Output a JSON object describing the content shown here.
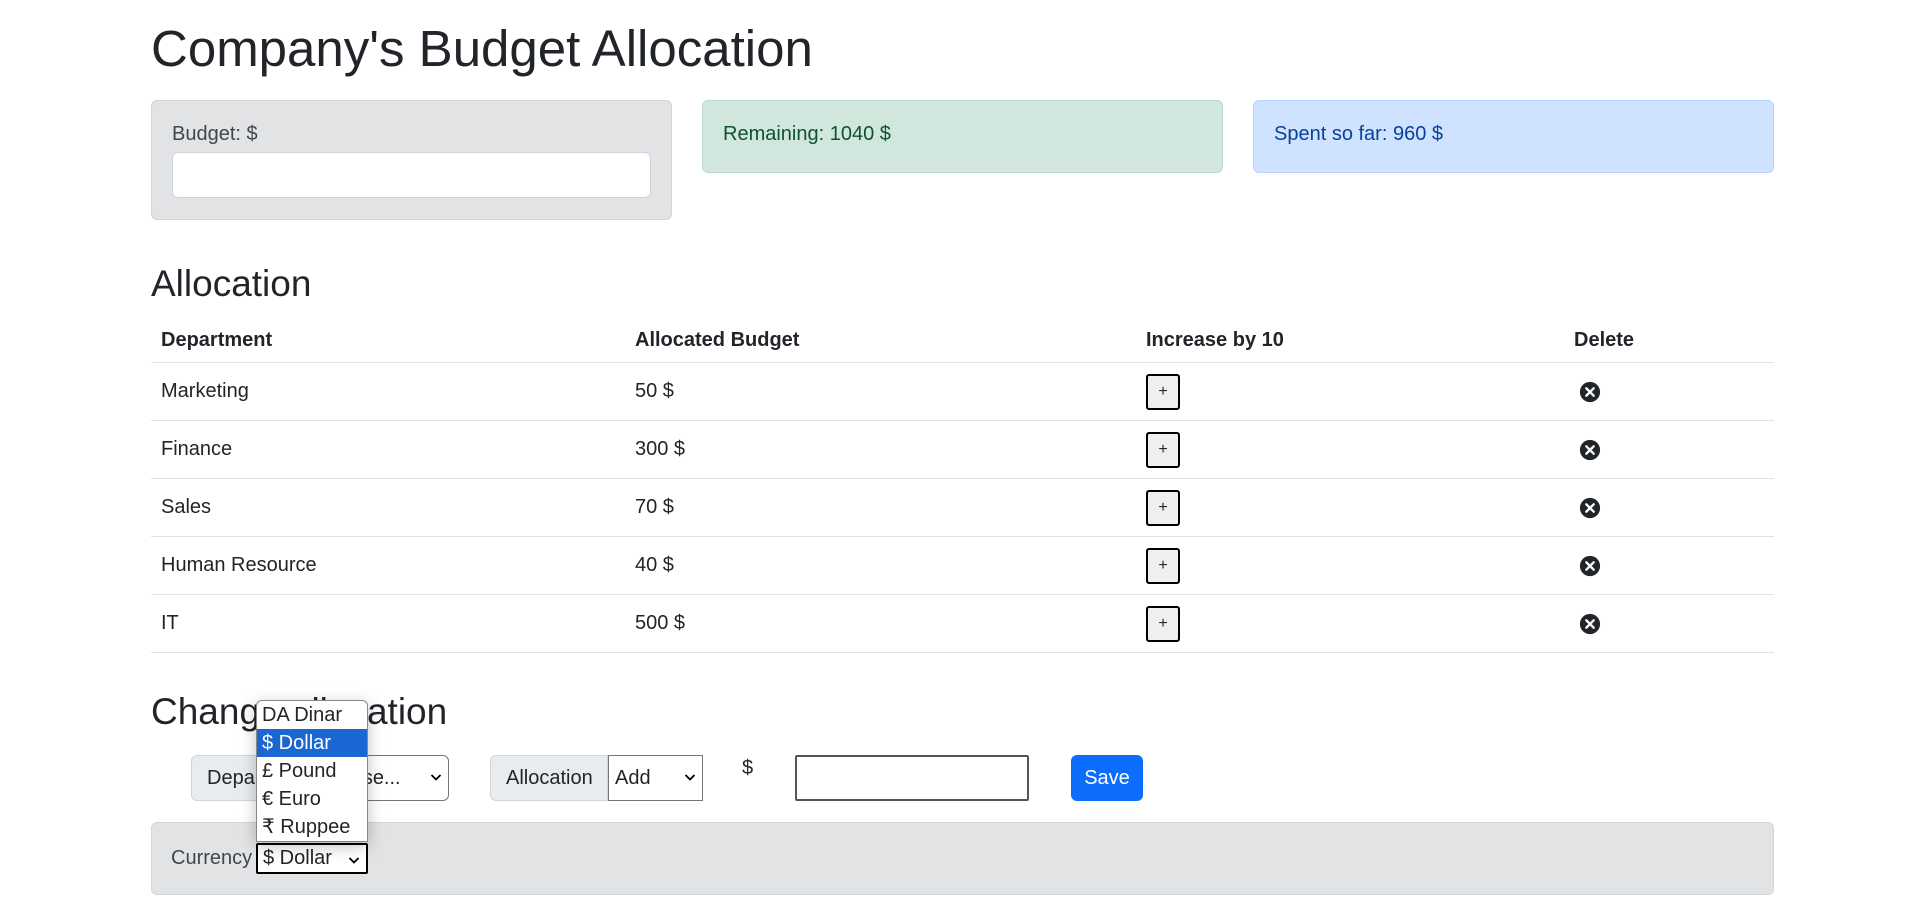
{
  "title": "Company's Budget Allocation",
  "cards": {
    "budget_label": "Budget: $",
    "budget_value": "",
    "remaining": "Remaining: 1040 $",
    "spent": "Spent so far: 960 $"
  },
  "allocation": {
    "heading": "Allocation",
    "headers": [
      "Department",
      "Allocated Budget",
      "Increase by 10",
      "Delete"
    ],
    "rows": [
      {
        "department": "Marketing",
        "budget": "50 $",
        "plus": "+"
      },
      {
        "department": "Finance",
        "budget": "300 $",
        "plus": "+"
      },
      {
        "department": "Sales",
        "budget": "70 $",
        "plus": "+"
      },
      {
        "department": "Human Resource",
        "budget": "40 $",
        "plus": "+"
      },
      {
        "department": "IT",
        "budget": "500 $",
        "plus": "+"
      }
    ]
  },
  "change": {
    "heading": "Change allocation",
    "department_label": "Department",
    "department_selected": "Choose...",
    "allocation_label": "Allocation",
    "action_selected": "Add",
    "currency_sign": "$",
    "amount_value": "",
    "save_label": "Save"
  },
  "currency": {
    "label": "Currency",
    "selected": "$ Dollar",
    "options": [
      "DA Dinar",
      "$ Dollar",
      "£ Pound",
      "€ Euro",
      "₹ Ruppee"
    ]
  },
  "colors": {
    "primary": "#0d6efd",
    "remaining_bg": "#d1e7dd",
    "spent_bg": "#cfe2ff",
    "secondary_bg": "#e2e3e5",
    "dropdown_highlight": "#1a66d2"
  }
}
